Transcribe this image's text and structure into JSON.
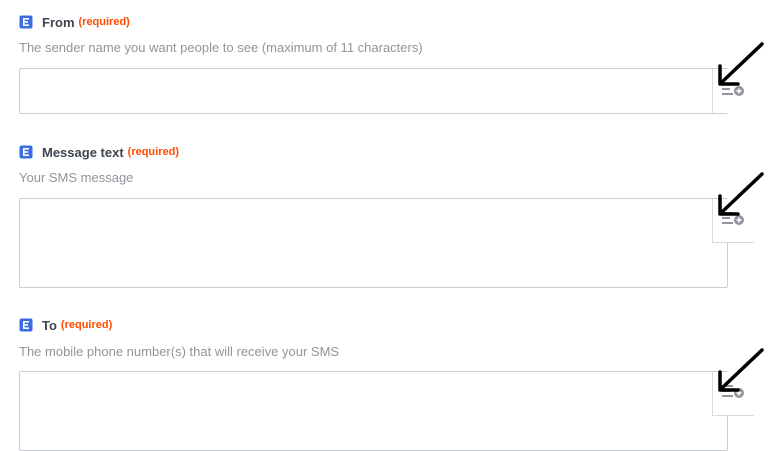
{
  "fields": [
    {
      "label": "From",
      "required": "(required)",
      "help": "The sender name you want people to see (maximum of 11 characters)",
      "value": ""
    },
    {
      "label": "Message text",
      "required": "(required)",
      "help": "Your SMS message",
      "value": ""
    },
    {
      "label": "To",
      "required": "(required)",
      "help": "The mobile phone number(s) that will receive your SMS",
      "value": ""
    }
  ],
  "icons": {
    "field_type": "text-type-icon",
    "insert": "insert-data-icon",
    "annotation": "arrow-annotation"
  },
  "colors": {
    "label": "#3d4650",
    "required": "#ff4a00",
    "help": "#8f959b",
    "type_icon": "#3b6ce4",
    "border": "#c9cdd1"
  }
}
